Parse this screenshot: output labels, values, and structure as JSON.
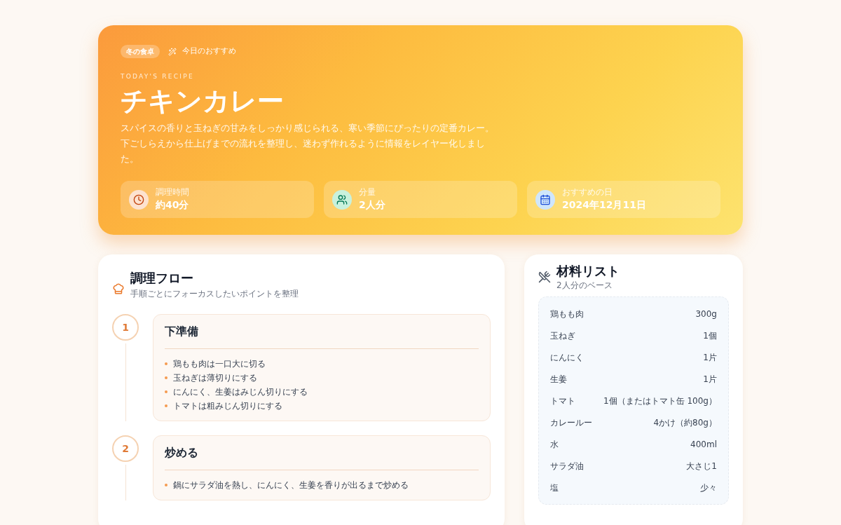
{
  "hero": {
    "tag": "冬の食卓",
    "recommend": "今日のおすすめ",
    "eyebrow": "TODAY'S RECIPE",
    "title": "チキンカレー",
    "description": "スパイスの香りと玉ねぎの甘みをしっかり感じられる、寒い季節にぴったりの定番カレー。下ごしらえから仕上げまでの流れを整理し、迷わず作れるように情報をレイヤー化しました。",
    "stats": [
      {
        "kind": "time",
        "label": "調理時間",
        "value": "約40分"
      },
      {
        "kind": "servings",
        "label": "分量",
        "value": "2人分"
      },
      {
        "kind": "date",
        "label": "おすすめの日",
        "value": "2024年12月11日"
      }
    ]
  },
  "flow": {
    "title": "調理フロー",
    "subtitle": "手順ごとにフォーカスしたいポイントを整理",
    "steps": [
      {
        "number": "1",
        "title": "下準備",
        "items": [
          "鶏もも肉は一口大に切る",
          "玉ねぎは薄切りにする",
          "にんにく、生姜はみじん切りにする",
          "トマトは粗みじん切りにする"
        ]
      },
      {
        "number": "2",
        "title": "炒める",
        "items": [
          "鍋にサラダ油を熱し、にんにく、生姜を香りが出るまで炒める"
        ]
      }
    ]
  },
  "ingredients": {
    "title": "材料リスト",
    "subtitle": "2人分のベース",
    "rows": [
      {
        "name": "鶏もも肉",
        "amount": "300g"
      },
      {
        "name": "玉ねぎ",
        "amount": "1個"
      },
      {
        "name": "にんにく",
        "amount": "1片"
      },
      {
        "name": "生姜",
        "amount": "1片"
      },
      {
        "name": "トマト",
        "amount": "1個（またはトマト缶 100g）"
      },
      {
        "name": "カレールー",
        "amount": "4かけ（約80g）"
      },
      {
        "name": "水",
        "amount": "400ml"
      },
      {
        "name": "サラダ油",
        "amount": "大さじ1"
      },
      {
        "name": "塩",
        "amount": "少々"
      }
    ]
  }
}
